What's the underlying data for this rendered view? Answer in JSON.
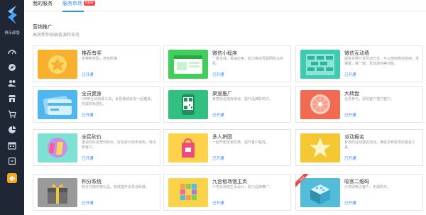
{
  "sidebar": {
    "title": "俱乐部版",
    "items": [
      {
        "icon": "dashboard-icon"
      },
      {
        "icon": "compass-icon"
      },
      {
        "icon": "people-icon"
      },
      {
        "icon": "shop-icon"
      },
      {
        "icon": "cart-icon"
      },
      {
        "icon": "pie-chart-icon"
      },
      {
        "icon": "calendar-icon"
      },
      {
        "icon": "app-icon"
      }
    ],
    "colors": {
      "bg": "#1f2734",
      "active": "#f5a623",
      "logo": "#4aa3ff"
    }
  },
  "tabs": [
    {
      "label": "我的服务"
    },
    {
      "label": "服务市场",
      "badge": "NEW",
      "active": true
    }
  ],
  "section": {
    "title": "营销推广",
    "subtitle": "高效帮你拓展客源和业务"
  },
  "cards": [
    {
      "title": "推荐有奖",
      "desc": "老带新奖励，老有所得",
      "link": "已开通",
      "thumb_color": "#f7b12e",
      "icon": "reward-icon"
    },
    {
      "title": "微信小程序",
      "desc": "一键生成，极速应用，助力移动互联网抢占商机。",
      "link": "已开通",
      "thumb_color": "#3fcf5a",
      "icon": "mini-program-icon"
    },
    {
      "title": "微信互动墙",
      "desc": "提供多种分享互动方式，可以使用微信签到，发弹幕，摇一摇，互动游戏等功能。",
      "link": "已开通",
      "thumb_color": "#3fcab2",
      "icon": "wall-icon"
    },
    {
      "title": "全员健身",
      "desc": "OA等互动资源工具，会员邀请好友一起健身，完成目标送礼。",
      "link": "已开通",
      "thumb_color": "#4fb6ee",
      "icon": "card-icon"
    },
    {
      "title": "渠道推广",
      "desc": "有意愿是独有渠道，提升品牌影响力。",
      "link": "已开通",
      "thumb_color": "#32c082",
      "icon": "qrcode-icon"
    },
    {
      "title": "大转盘",
      "desc": "全员参与，深挖客户潜力客户。",
      "link": "已开通",
      "thumb_color": "#f06b52",
      "icon": "wheel-icon"
    },
    {
      "title": "全民砍价",
      "desc": "邀请你好友帮你砍价，好友拆分快乐抢购，吸引新客户。",
      "link": "已开通",
      "thumb_color": "#b98ad8",
      "icon": "bargain-icon"
    },
    {
      "title": "多人拼团",
      "desc": "一起开团享受优惠，提升客户黏性。",
      "link": "已开通",
      "thumb_color": "#ed4c79",
      "icon": "group-buy-icon"
    },
    {
      "title": "派动报名",
      "desc": "有效的在线报名活动，满足多种需求的报名工具。",
      "link": "已开通",
      "thumb_color": "#f5c833",
      "icon": "star-icon"
    },
    {
      "title": "积分系统",
      "desc": "积分兑换实物礼品，有效提升会员活跃度。",
      "link": "已开通",
      "thumb_color": "#9a9a9a",
      "icon": "gift-icon"
    },
    {
      "title": "九宫格场馆主页",
      "desc": "个性化场馆主页设计，助力品牌推广。",
      "link": "已开通",
      "thumb_color": "#fbd34a",
      "icon": "grid-icon"
    },
    {
      "title": "吸客二维码",
      "desc": "分享即吸引客户，无需购买。",
      "link": "已开通",
      "thumb_color": "#53bcd8",
      "icon": "qrcode-box-icon",
      "ribbon": "New"
    }
  ]
}
